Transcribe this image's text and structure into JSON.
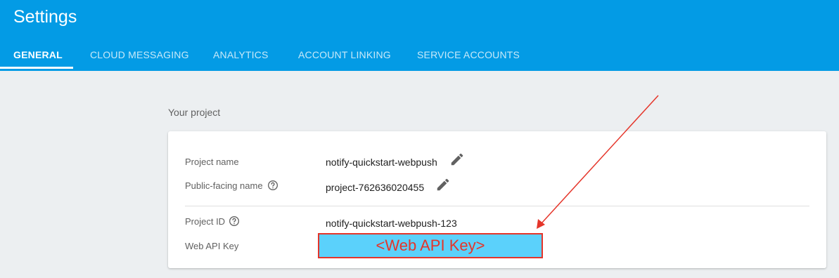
{
  "header": {
    "title": "Settings",
    "tabs": [
      {
        "label": "GENERAL",
        "active": true
      },
      {
        "label": "CLOUD MESSAGING",
        "active": false
      },
      {
        "label": "ANALYTICS",
        "active": false
      },
      {
        "label": "ACCOUNT LINKING",
        "active": false
      },
      {
        "label": "SERVICE ACCOUNTS",
        "active": false
      }
    ]
  },
  "project": {
    "section_label": "Your project",
    "fields": [
      {
        "label": "Project name",
        "value": "notify-quickstart-webpush"
      },
      {
        "label": "Public-facing name",
        "value": "project-762636020455"
      },
      {
        "label": "Project ID",
        "value": "notify-quickstart-webpush-123"
      },
      {
        "label": "Web API Key",
        "value": "<Web API Key>"
      }
    ]
  },
  "icons": {
    "edit": "edit-pencil-icon",
    "help": "help-circle-icon"
  },
  "colors": {
    "header": "#039be5",
    "background": "#eceff1",
    "annotation_red": "#e5352a",
    "highlight_blue": "#5bd1fb"
  }
}
